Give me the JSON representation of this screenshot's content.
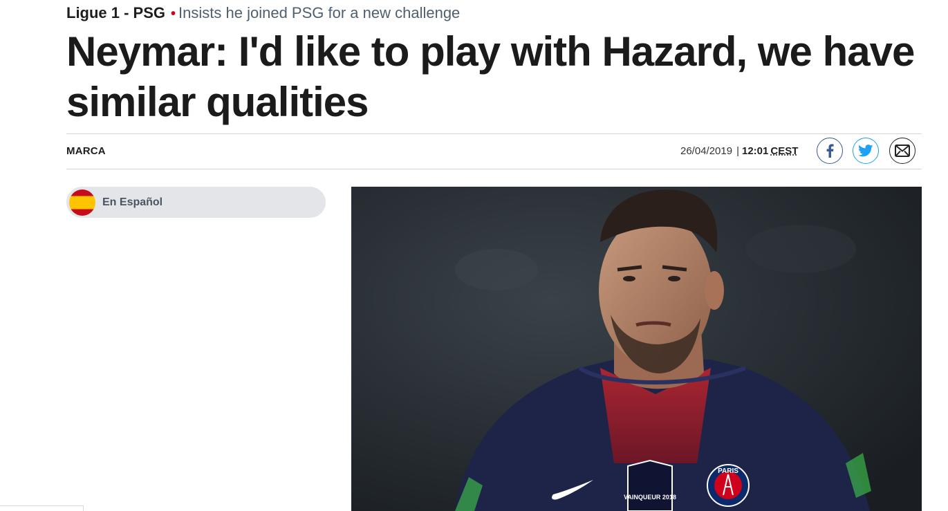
{
  "kicker": {
    "section": "Ligue 1 - PSG",
    "separator": "•",
    "subtitle": "Insists he joined PSG for a new challenge"
  },
  "headline": "Neymar: I'd like to play with Hazard, we have similar qualities",
  "meta": {
    "author": "MARCA",
    "date": "26/04/2019",
    "separator": "|",
    "time": "12:01",
    "timezone": "CEST"
  },
  "share": {
    "facebook_icon": "facebook-icon",
    "twitter_icon": "twitter-icon",
    "email_icon": "email-icon"
  },
  "language_link": {
    "label": "En Español",
    "flag_icon": "spain-flag-icon"
  },
  "photo": {
    "crest_text": "PARIS",
    "badge_text": "VAINQUEUR 2018"
  },
  "colors": {
    "kicker_dot": "#d0021b",
    "facebook": "#3b5998",
    "twitter": "#1da1f2",
    "pill_bg": "#e3e5e8"
  }
}
